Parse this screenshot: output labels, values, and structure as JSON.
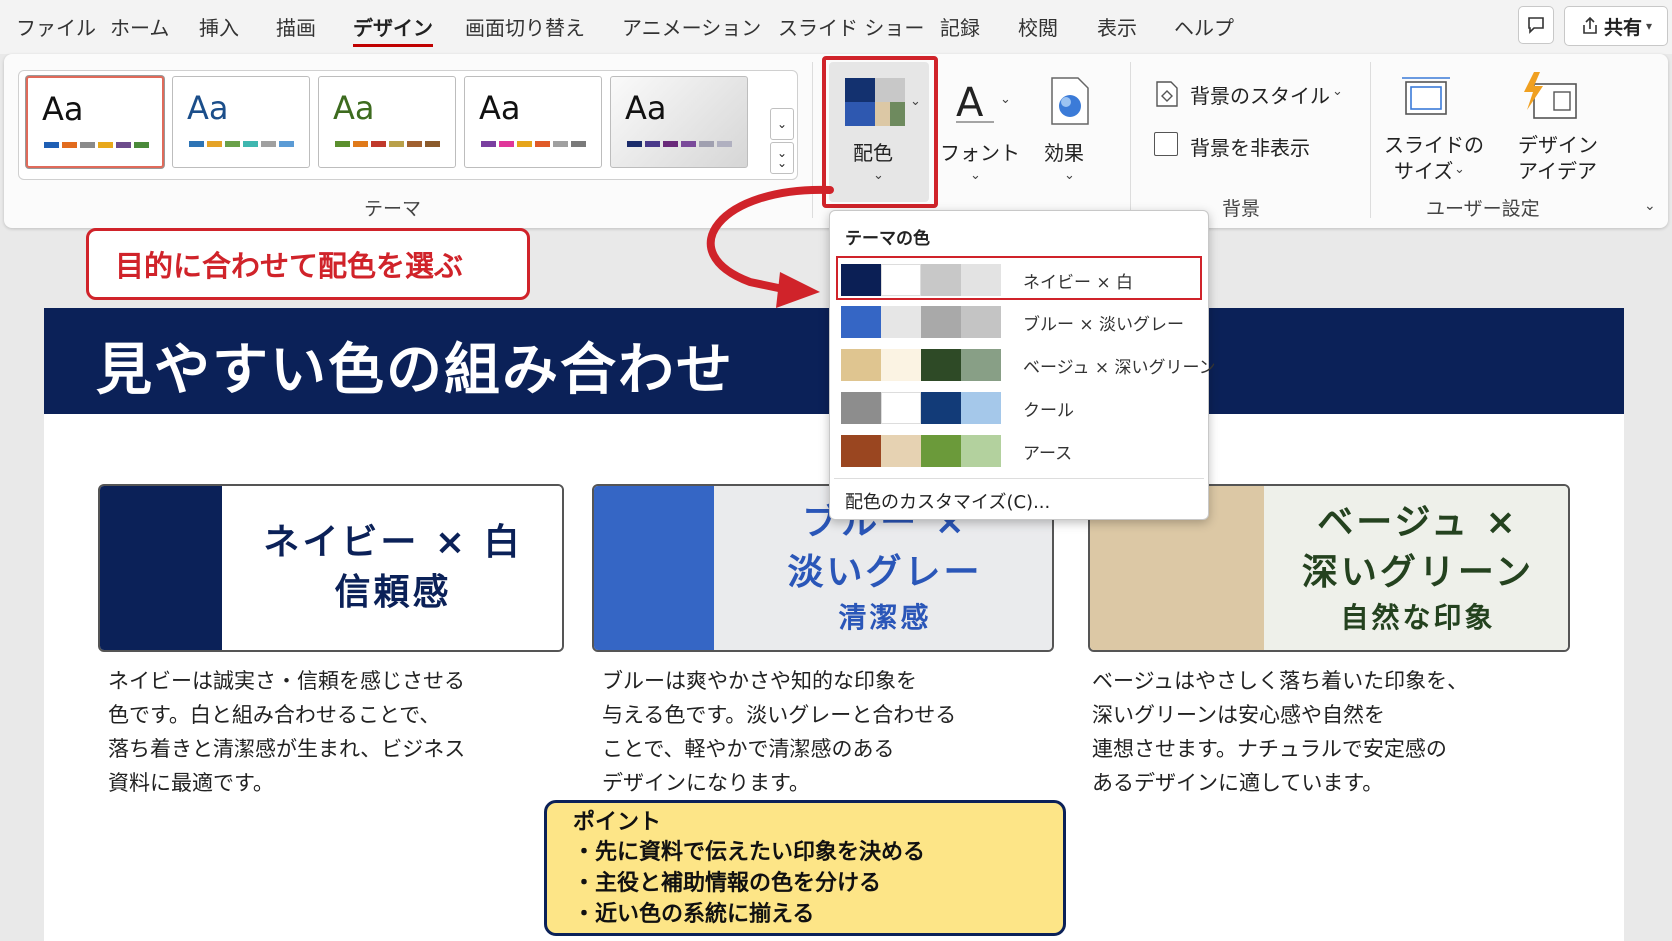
{
  "menubar": {
    "tabs": [
      "ファイル",
      "ホーム",
      "挿入",
      "描画",
      "デザイン",
      "画面切り替え",
      "アニメーション",
      "スライド ショー",
      "記録",
      "校閲",
      "表示",
      "ヘルプ"
    ],
    "active_tab": "デザイン",
    "share_label": "共有"
  },
  "ribbon": {
    "themes_group_label": "テーマ",
    "theme_thumb_text": "Aa",
    "themes": [
      {
        "colors": [
          "#1f5fb4",
          "#e26b1d",
          "#8a8a8a",
          "#e8a81a",
          "#6d4c8c",
          "#4a8a3a"
        ]
      },
      {
        "colors": [
          "#2e74b5",
          "#e5a327",
          "#6aa14a",
          "#3fb7b0",
          "#a0a0a0",
          "#5b9bd5"
        ]
      },
      {
        "colors": [
          "#5b8f2e",
          "#e07a1a",
          "#c0392b",
          "#b9a04a",
          "#a06030",
          "#8b5a2b"
        ]
      },
      {
        "colors": [
          "#7a3fa0",
          "#e0379a",
          "#e6a51a",
          "#e05a28",
          "#a0a0a0",
          "#7a7a7a"
        ]
      },
      {
        "colors": [
          "#1b2c6b",
          "#4a3a8a",
          "#6a2a7a",
          "#7a4a9a",
          "#a0a0b0",
          "#b0b0c0"
        ]
      }
    ],
    "variants_label": "配色",
    "font_label": "フォント",
    "effects_label": "効果",
    "background_style_label": "背景のスタイル",
    "hide_background_label": "背景を非表示",
    "background_group_label": "背景",
    "slide_size_label_line1": "スライドの",
    "slide_size_label_line2": "サイズ",
    "design_ideas_label_line1": "デザイン",
    "design_ideas_label_line2": "アイデア",
    "user_settings_group_label": "ユーザー設定"
  },
  "dropdown": {
    "heading": "テーマの色",
    "items": [
      {
        "label": "ネイビー × 白",
        "colors": [
          "#0b1f55",
          "#ffffff",
          "#c8c8c8",
          "#e3e3e3"
        ],
        "selected": true
      },
      {
        "label": "ブルー × 淡いグレー",
        "colors": [
          "#3566c5",
          "#e6e6e6",
          "#a9a9a9",
          "#c4c4c4"
        ],
        "selected": false
      },
      {
        "label": "ベージュ × 深いグリーン",
        "colors": [
          "#dfc590",
          "#fbf3e3",
          "#2e4a26",
          "#889f86"
        ],
        "selected": false
      },
      {
        "label": "クール",
        "colors": [
          "#8d8d8d",
          "#ffffff",
          "#123b78",
          "#a5c8ea"
        ],
        "selected": false
      },
      {
        "label": "アース",
        "colors": [
          "#9a4620",
          "#e6d2b2",
          "#6b9a3a",
          "#b3d19e"
        ],
        "selected": false
      }
    ],
    "customize_label": "配色のカスタマイズ(C)..."
  },
  "callout": {
    "text": "目的に合わせて配色を選ぶ"
  },
  "slide": {
    "title": "見やすい色の組み合わせ",
    "cards": [
      {
        "title": "ネイビー × 白",
        "subtitle": "信頼感",
        "swatch_color": "#0b2158",
        "bg_color": "#ffffff",
        "text_color": "#0b2158",
        "desc": [
          "ネイビーは誠実さ・信頼を感じさせる",
          "色です。白と組み合わせることで、",
          "落ち着きと清潔感が生まれ、ビジネス",
          "資料に最適です。"
        ]
      },
      {
        "title_line1": "ブルー ×",
        "title_line2": "淡いグレー",
        "subtitle": "清潔感",
        "swatch_color": "#3566c5",
        "bg_color": "#eaebed",
        "text_color": "#2a56b8",
        "desc": [
          "ブルーは爽やかさや知的な印象を",
          "与える色です。淡いグレーと合わせる",
          "ことで、軽やかで清潔感のある",
          "デザインになります。"
        ]
      },
      {
        "title_line1": "ベージュ ×",
        "title_line2": "深いグリーン",
        "subtitle": "自然な印象",
        "swatch_color": "#dcc8a5",
        "bg_color": "#eef0ea",
        "text_color": "#24421f",
        "desc": [
          "ベージュはやさしく落ち着いた印象を、",
          "深いグリーンは安心感や自然を",
          "連想させます。ナチュラルで安定感の",
          "あるデザインに適しています。"
        ]
      }
    ],
    "point": {
      "heading": "ポイント",
      "items": [
        "・先に資料で伝えたい印象を決める",
        "・主役と補助情報の色を分ける",
        "・近い色の系統に揃える"
      ]
    }
  },
  "colors": {
    "accent_red": "#d0232a",
    "navy": "#0b2158",
    "point_bg": "#fde587"
  }
}
